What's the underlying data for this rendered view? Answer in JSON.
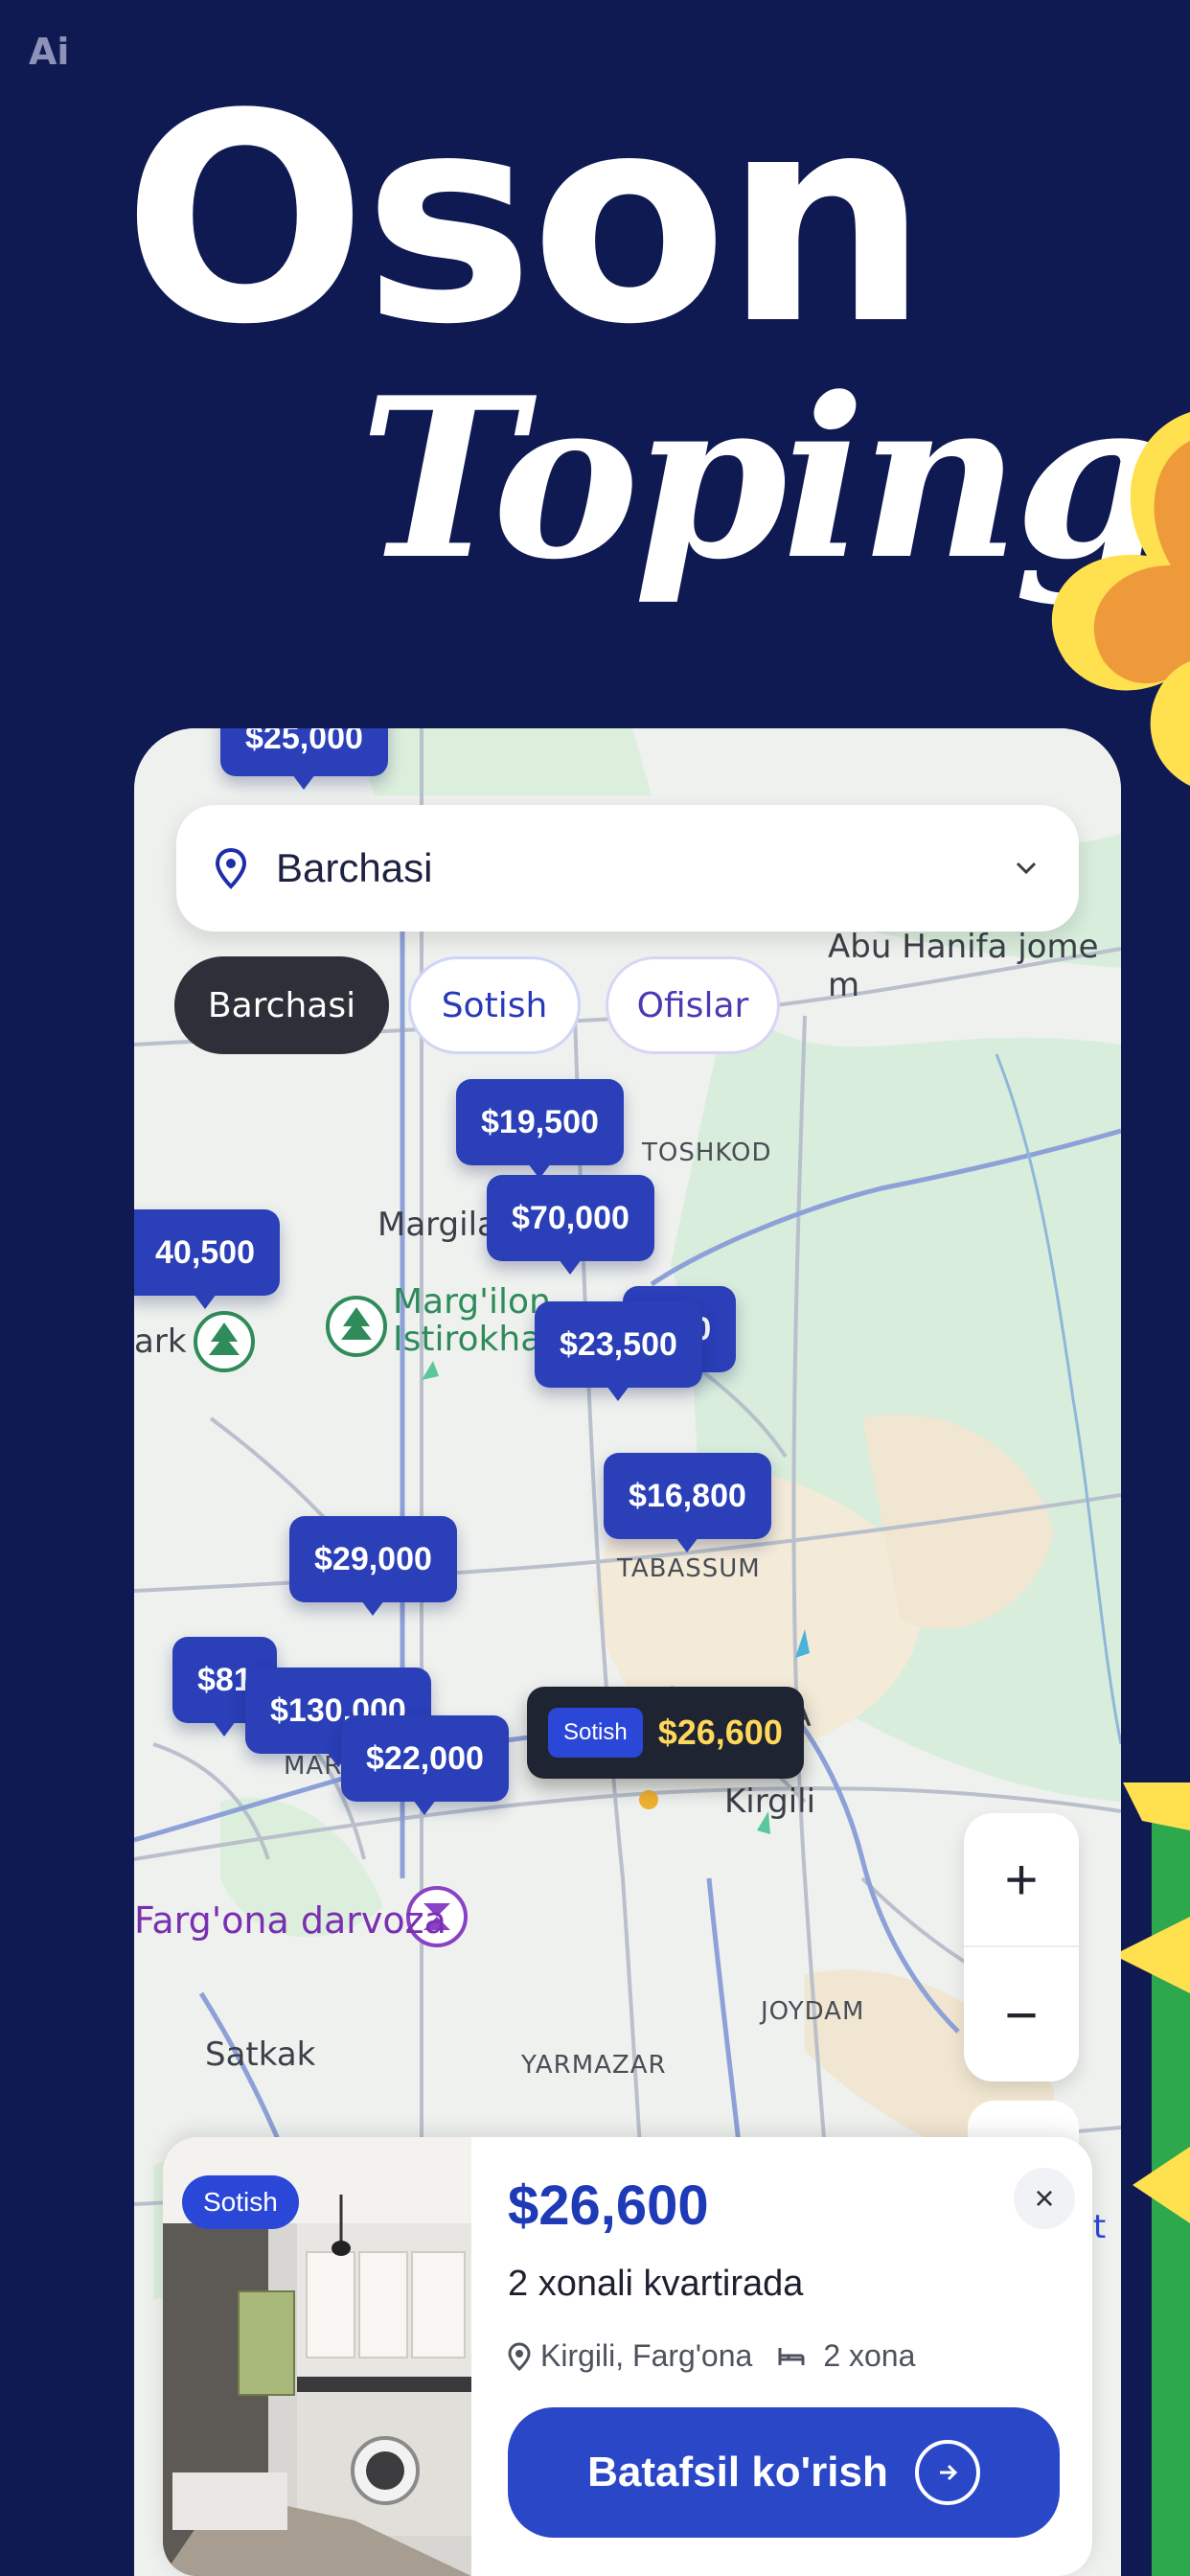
{
  "brand": {
    "ai_badge": "Ai"
  },
  "headline": {
    "line1": "Oson",
    "line2": "Toping"
  },
  "search": {
    "label": "Barchasi"
  },
  "filters": [
    {
      "label": "Barchasi",
      "active": true
    },
    {
      "label": "Sotish",
      "active": false
    },
    {
      "label": "Ofislar",
      "active": false
    }
  ],
  "map_labels": {
    "abu_hanifa": "Abu Hanifa jome m",
    "toshkod": "TOSHKOD",
    "margilan": "Margila",
    "park": "ark",
    "margilon_line1": "Marg'ilon",
    "margilon_line2": "Istirokha",
    "tabassum": "TABASSUM",
    "kirgili": "Kirgili",
    "ba": "BA",
    "mar": "MAR",
    "fargona": "Farg'ona darvoza",
    "joydam": "JOYDAM",
    "satkak": "Satkak",
    "yarmazar": "YARMAZAR",
    "edge_et": "et"
  },
  "prices": {
    "top_partial": "$25,000",
    "p1": "$19,500",
    "p2": "$70,000",
    "p3": "40,500",
    "p4": "$23,500",
    "p5": ",000",
    "p6": "$16,800",
    "p7": "$29,000",
    "p8": "$81",
    "p9": "$130,000",
    "p10": "$22,000",
    "selected_tag": "Sotish",
    "selected_value": "$26,600"
  },
  "zoom": {
    "plus": "+",
    "minus": "−"
  },
  "card": {
    "badge": "Sotish",
    "price": "$26,600",
    "title": "2 xonali kvartirada",
    "location": "Kirgili, Farg'ona",
    "rooms": "2 xona",
    "button": "Batafsil ko'rish",
    "close": "×"
  },
  "colors": {
    "background": "#101a52",
    "accent": "#2a3fb8",
    "selected_price": "#ffd75a"
  },
  "icons": [
    "location-pin-icon",
    "chevron-down-icon",
    "park-tree-icon",
    "gate-icon",
    "close-icon",
    "arrow-right-icon",
    "bed-icon"
  ]
}
